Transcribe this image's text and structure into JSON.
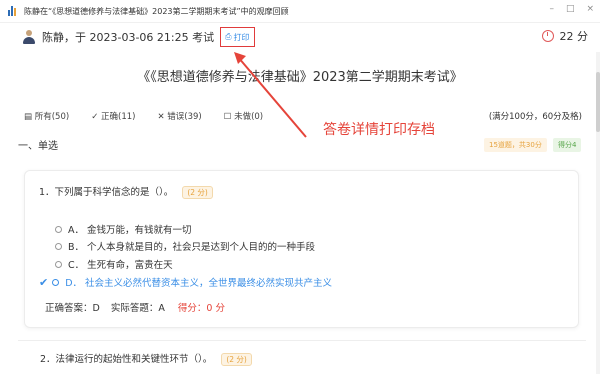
{
  "window": {
    "title": "陈静在“《思想道德修养与法律基础》2023第二学期期末考试”中的观摩回顾",
    "minimize": "–",
    "maximize": "□",
    "close": "×"
  },
  "header": {
    "submit_info": "陈静，于 2023-03-06 21:25 考试",
    "print_label": "打印",
    "timer": "22 分"
  },
  "exam": {
    "title": "《《思想道德修养与法律基础》2023第二学期期末考试》"
  },
  "filters": {
    "all": "所有(50)",
    "correct": "正确(11)",
    "wrong": "错误(39)",
    "undone": "未做(0)"
  },
  "score_info": "(满分100分，60分及格)",
  "annotation": "答卷详情打印存档",
  "section": {
    "title": "一、单选",
    "count_badge": "15道题，共30分",
    "score_badge": "得分4"
  },
  "question1": {
    "title": "1．下列属于科学信念的是（）。",
    "points": "(2 分)",
    "options": [
      "A．  金钱万能，有钱就有一切",
      "B．  个人本身就是目的，社会只是达到个人目的的一种手段",
      "C．  生死有命，富贵在天",
      "D．  社会主义必然代替资本主义，全世界最终必然实现共产主义"
    ],
    "correct_answer": "正确答案：D",
    "actual_answer": "实际答题：A",
    "score": "得分：0 分"
  },
  "question2": {
    "title": "2．法律运行的起始性和关键性环节（）。",
    "points": "(2 分)"
  },
  "colors": {
    "accent": "#3a8ee6",
    "alert": "#e5443a",
    "badge": "#e6a23c",
    "success": "#57a64a"
  }
}
